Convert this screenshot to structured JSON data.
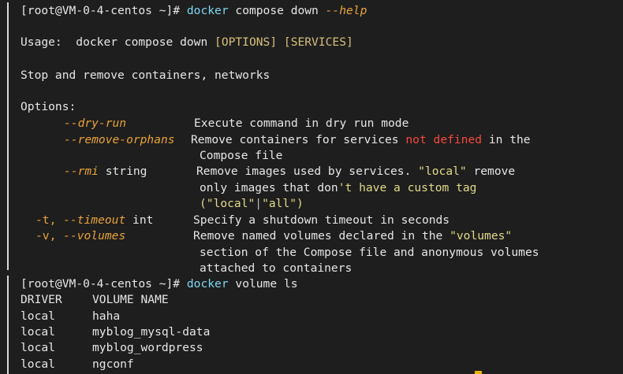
{
  "session1": {
    "prompt": "[root@VM-0-4-centos ~]#",
    "command_word": "docker",
    "command_rest": "compose down",
    "command_flag": "--help"
  },
  "help": {
    "usage_label": "Usage:",
    "usage_cmd": "docker compose down",
    "usage_options": "[OPTIONS]",
    "usage_services": "[SERVICES]",
    "description": "Stop and remove containers, networks",
    "options_label": "Options:",
    "options": [
      {
        "flag": "--dry-run",
        "desc": "Execute command in dry run mode"
      },
      {
        "flag": "--remove-orphans",
        "desc_a": "Remove containers for services",
        "desc_red": "not defined",
        "desc_b": "in the",
        "desc_cont": "Compose file"
      },
      {
        "flag": "--rmi",
        "arg": "string",
        "desc_a": "Remove images used by services.",
        "desc_str": "\"local\"",
        "desc_b": "remove",
        "cont_a": "only images that don",
        "cont_str": "'t have a custom tag",
        "cont2_a": "(\"local\"",
        "cont2_pipe": "|",
        "cont2_b": "\"all\")"
      },
      {
        "short": "-t,",
        "flag": "--timeout",
        "arg": "int",
        "desc": "Specify a shutdown timeout in seconds"
      },
      {
        "short": "-v,",
        "flag": "--volumes",
        "desc_a": "Remove named volumes declared in the",
        "desc_str": "\"volumes\"",
        "desc_cont1": "section of the Compose file and anonymous volumes",
        "desc_cont2": "attached to containers"
      }
    ]
  },
  "session2": {
    "prompt": "[root@VM-0-4-centos ~]#",
    "command_word": "docker",
    "command_rest": "volume ls"
  },
  "volumes_table": {
    "headers": [
      "DRIVER",
      "VOLUME NAME"
    ],
    "rows": [
      [
        "local",
        "haha"
      ],
      [
        "local",
        "myblog_mysql-data"
      ],
      [
        "local",
        "myblog_wordpress"
      ],
      [
        "local",
        "ngconf"
      ]
    ]
  }
}
